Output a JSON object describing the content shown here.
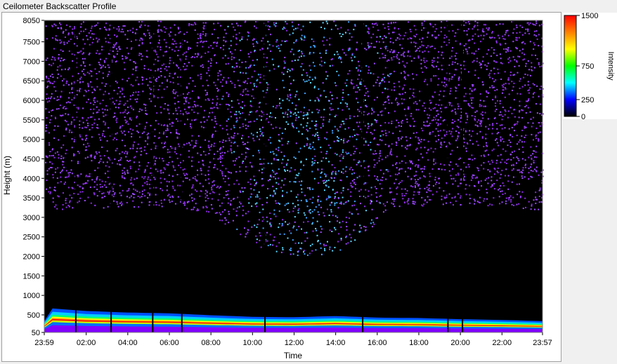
{
  "window": {
    "title": "Ceilometer Backscatter Profile"
  },
  "chart_data": {
    "type": "heatmap",
    "title": "",
    "xlabel": "Time",
    "ylabel": "Height (m)",
    "x_ticks": [
      "23:59",
      "02:00",
      "04:00",
      "06:00",
      "08:00",
      "10:00",
      "12:00",
      "14:00",
      "16:00",
      "18:00",
      "20:00",
      "22:00",
      "23:57"
    ],
    "x_tick_hours": [
      -0.0167,
      2,
      4,
      6,
      8,
      10,
      12,
      14,
      16,
      18,
      20,
      22,
      23.95
    ],
    "xlim_hours": [
      -0.0167,
      23.95
    ],
    "y_ticks": [
      50,
      500,
      1000,
      1500,
      2000,
      2500,
      3000,
      3500,
      4000,
      4500,
      5000,
      5500,
      6000,
      6500,
      7000,
      7500,
      8050
    ],
    "ylim": [
      50,
      8050
    ],
    "colorbar": {
      "title": "Intensity",
      "ticks": [
        0,
        250,
        750,
        1500
      ],
      "range": [
        0,
        1500
      ],
      "stops": [
        "#000000",
        "#0000ff",
        "#00ffff",
        "#00ff00",
        "#ffff00",
        "#ff8000",
        "#ff0000"
      ]
    },
    "boundary_layer_top_m": [
      {
        "hour": 0,
        "height": 680
      },
      {
        "hour": 2,
        "height": 600
      },
      {
        "hour": 4,
        "height": 560
      },
      {
        "hour": 6,
        "height": 540
      },
      {
        "hour": 8,
        "height": 490
      },
      {
        "hour": 10,
        "height": 450
      },
      {
        "hour": 12,
        "height": 440
      },
      {
        "hour": 14,
        "height": 470
      },
      {
        "hour": 16,
        "height": 430
      },
      {
        "hour": 18,
        "height": 420
      },
      {
        "hour": 20,
        "height": 390
      },
      {
        "hour": 22,
        "height": 370
      },
      {
        "hour": 23.95,
        "height": 340
      }
    ],
    "aerosol_dome_top_m": [
      {
        "hour": 0,
        "height": 3200
      },
      {
        "hour": 6,
        "height": 3300
      },
      {
        "hour": 8,
        "height": 3100
      },
      {
        "hour": 10,
        "height": 2300
      },
      {
        "hour": 12,
        "height": 2000
      },
      {
        "hour": 14,
        "height": 2100
      },
      {
        "hour": 15.5,
        "height": 2600
      },
      {
        "hour": 16.5,
        "height": 3300
      },
      {
        "hour": 20,
        "height": 3300
      },
      {
        "hour": 23.95,
        "height": 3200
      }
    ],
    "data_gaps_hours": [
      1.5,
      3.2,
      5.2,
      6.6,
      10.6,
      15.3,
      19.4,
      20.1
    ]
  }
}
